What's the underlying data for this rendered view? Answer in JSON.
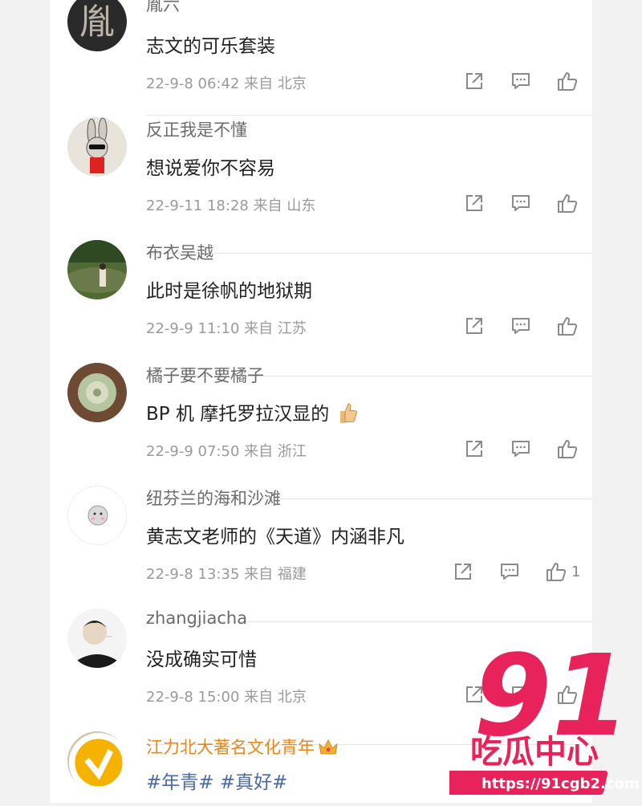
{
  "comments": [
    {
      "name": "胤六",
      "text": "志文的可乐套装",
      "date": "22-9-8 06:42",
      "origin_prefix": "来自",
      "origin": "北京",
      "likes": ""
    },
    {
      "name": "反正我是不懂",
      "text": "想说爱你不容易",
      "date": "22-9-11 18:28",
      "origin_prefix": "来自",
      "origin": "山东",
      "likes": ""
    },
    {
      "name": "布衣吴越",
      "text": "此时是徐帆的地狱期",
      "date": "22-9-9 11:10",
      "origin_prefix": "来自",
      "origin": "江苏",
      "likes": ""
    },
    {
      "name": "橘子要不要橘子",
      "text": "BP 机 摩托罗拉汉显的",
      "date": "22-9-9 07:50",
      "origin_prefix": "来自",
      "origin": "浙江",
      "likes": ""
    },
    {
      "name": "纽芬兰的海和沙滩",
      "text": "黄志文老师的《天道》内涵非凡",
      "date": "22-9-8 13:35",
      "origin_prefix": "来自",
      "origin": "福建",
      "likes": "1"
    },
    {
      "name": "zhangjiacha",
      "text": "没成确实可惜",
      "date": "22-9-8 15:00",
      "origin_prefix": "来自",
      "origin": "北京",
      "likes": ""
    },
    {
      "name": "江力北大著名文化青年",
      "text_tag1": "#年青#",
      "text_tag2": "#真好#"
    }
  ],
  "watermark": {
    "big": "91",
    "cn": "吃瓜中心",
    "url": "https://91cgb2.com"
  },
  "colors": {
    "name_vip": "#e8861b",
    "tag": "#4a69a8",
    "watermark": "#e8225a"
  }
}
